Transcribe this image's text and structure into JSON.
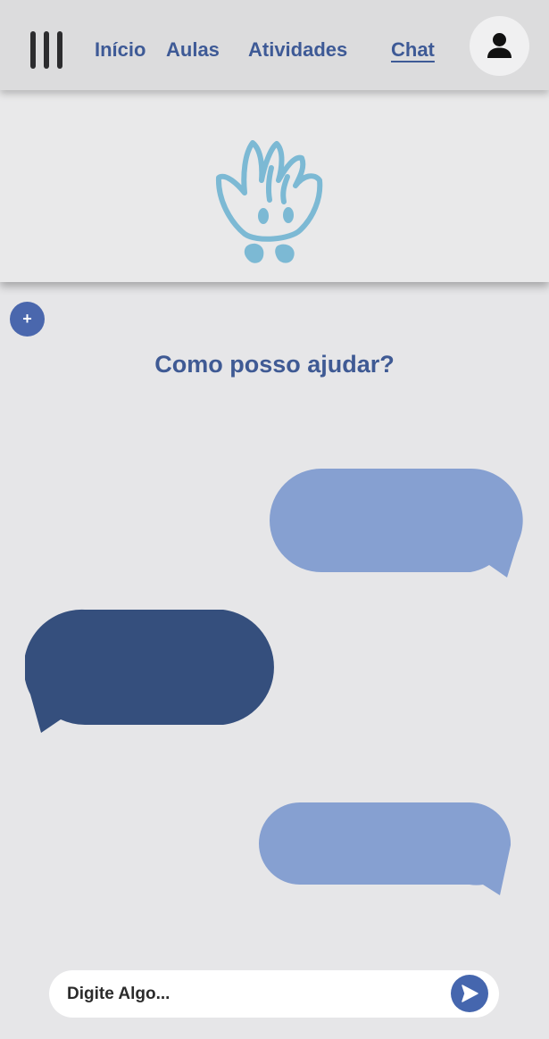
{
  "nav": {
    "menu_icon": "hamburger-menu-icon",
    "links": [
      {
        "label": "Início"
      },
      {
        "label": "Aulas"
      },
      {
        "label": "Atividades"
      },
      {
        "label": "Chat",
        "active": true
      }
    ],
    "profile_icon": "user-icon"
  },
  "banner": {
    "mascot_icon": "hand-mascot-icon"
  },
  "chat": {
    "new_chat_label": "+",
    "heading": "Como posso ajudar?",
    "messages": [
      {
        "sender": "user",
        "text": ""
      },
      {
        "sender": "assistant",
        "text": ""
      },
      {
        "sender": "user",
        "text": ""
      }
    ]
  },
  "composer": {
    "placeholder": "Digite Algo...",
    "value": "",
    "send_icon": "send-arrow-icon"
  },
  "colors": {
    "primary": "#3e5a96",
    "user_bubble": "#86a0d1",
    "assistant_bubble": "#354f7d",
    "header_bg": "#dcdcdd",
    "page_bg": "#e6e6e8",
    "mascot": "#7cb9d4"
  }
}
